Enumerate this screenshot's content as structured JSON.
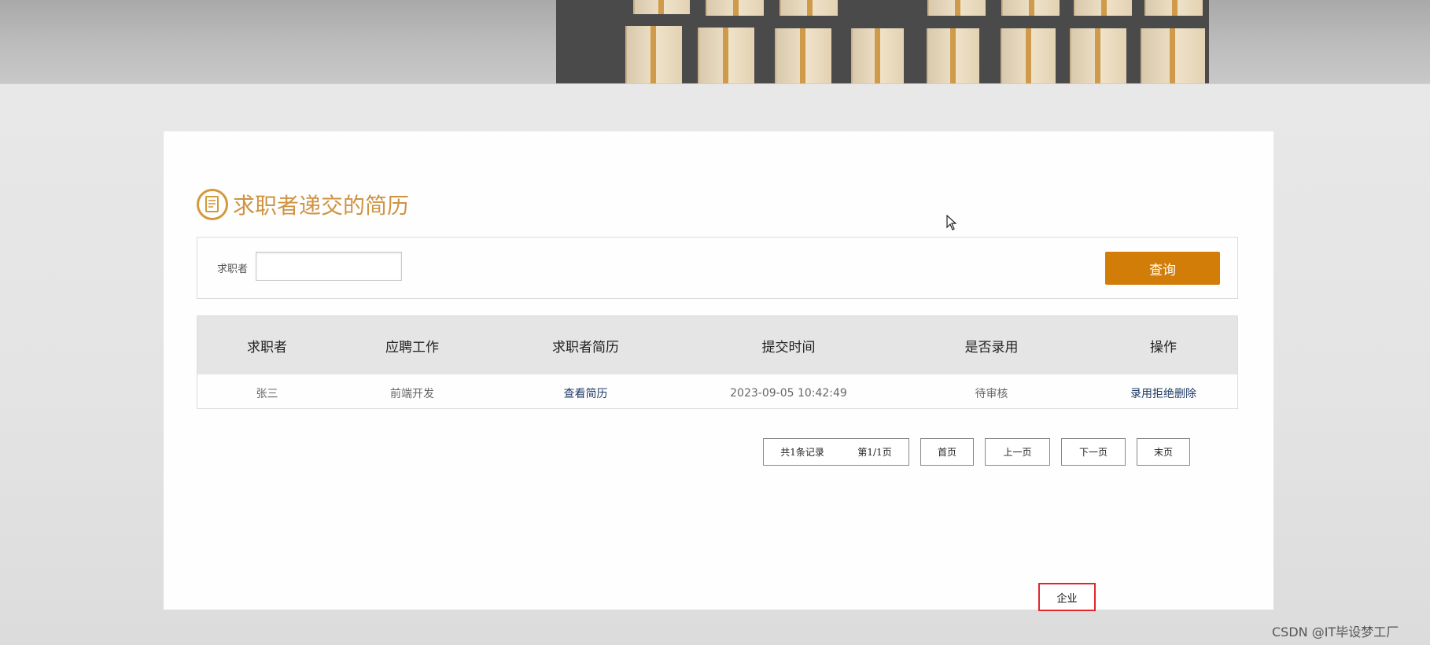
{
  "page": {
    "heading": "求职者递交的简历",
    "heading_icon": "document-icon",
    "accent_color": "#d27d08",
    "title_color": "#cf9342"
  },
  "search": {
    "label": "求职者",
    "value": "",
    "placeholder": "",
    "button_label": "查询"
  },
  "table": {
    "headers": [
      "求职者",
      "应聘工作",
      "求职者简历",
      "提交时间",
      "是否录用",
      "操作"
    ],
    "rows": [
      {
        "applicant": "张三",
        "job": "前端开发",
        "resume_link": "查看简历",
        "submit_time": "2023-09-05 10:42:49",
        "status": "待审核",
        "actions": {
          "hire": "录用",
          "reject": "拒绝",
          "delete": "删除"
        }
      }
    ]
  },
  "pagination": {
    "total": "共1条记录",
    "page": "第1/1页",
    "first": "首页",
    "prev": "上一页",
    "next": "下一页",
    "last": "末页"
  },
  "role_tag": "企业",
  "watermark": "CSDN @IT毕设梦工厂"
}
